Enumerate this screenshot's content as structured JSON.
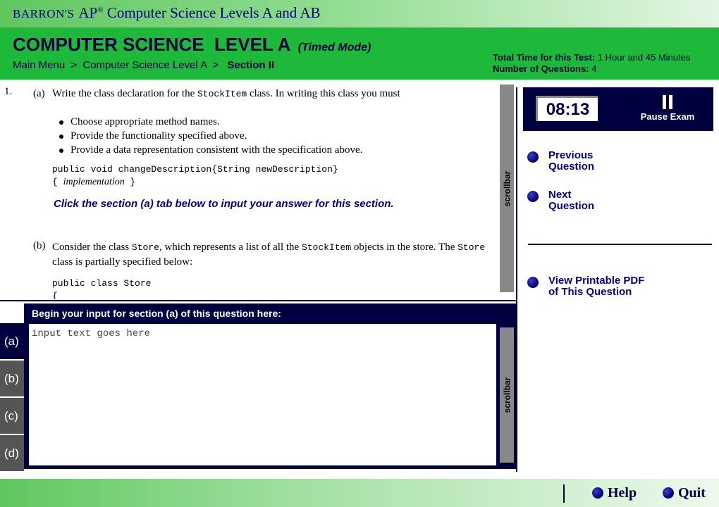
{
  "app": {
    "publisher": "BARRON'S",
    "title_prefix": "AP",
    "title_reg": "®",
    "title_rest": "Computer Science Levels A and AB"
  },
  "header": {
    "section_title": "COMPUTER SCIENCE  LEVEL A",
    "mode": "(Timed Mode)",
    "breadcrumb": {
      "main_menu": "Main Menu",
      "sep": ">",
      "level": "Computer Science Level A",
      "current": "Section II"
    },
    "total_time_label": "Total Time for this Test:",
    "total_time_value": "1 Hour and 45 Minutes",
    "num_questions_label": "Number of Questions:",
    "num_questions_value": "4"
  },
  "question": {
    "number": "1.",
    "part_a_label": "(a)",
    "part_a_text_1": "Write the class declaration for the",
    "part_a_code": "StockItem",
    "part_a_text_2": "class. In writing this class you must",
    "bullets": [
      "Choose appropriate method names.",
      "Provide the functionality specified above.",
      "Provide a data representation consistent with the specification above."
    ],
    "code_line_1": "public void changeDescription{String newDescription}",
    "code_line_2_open": "{",
    "code_line_2_impl": "implementation",
    "code_line_2_close": "}",
    "instruction": "Click the section (a) tab below to input your answer for this section.",
    "part_b_label": "(b)",
    "part_b_text_1": "Consider the class",
    "part_b_code_1": "Store",
    "part_b_text_2": ", which represents a list of all the",
    "part_b_code_2": "StockItem",
    "part_b_text_3": "objects in the store. The",
    "part_b_code_3": "Store",
    "part_b_text_4": "class is partially specified below:",
    "code_b_line_1": "public class Store",
    "code_b_line_2": "{"
  },
  "scrollbars": {
    "question_label": "scrollbar",
    "input_label": "scrollbar"
  },
  "input_panel": {
    "header": "Begin your input for section (a) of this question here:",
    "placeholder": "input text goes here",
    "value": ""
  },
  "section_tabs": [
    {
      "label": "(a)",
      "active": true
    },
    {
      "label": "(b)",
      "active": false
    },
    {
      "label": "(c)",
      "active": false
    },
    {
      "label": "(d)",
      "active": false
    }
  ],
  "timer": {
    "time": "08:13",
    "pause_label": "Pause Exam"
  },
  "nav": {
    "previous_line1": "Previous",
    "previous_line2": "Question",
    "next_line1": "Next",
    "next_line2": "Question",
    "pdf_line1": "View Printable PDF",
    "pdf_line2": "of This Question"
  },
  "footer": {
    "help": "Help",
    "quit": "Quit"
  },
  "colors": {
    "navy": "#000040",
    "header_green": "#1eb83a",
    "link_blue": "#000080",
    "tab_gray": "#555555",
    "scrollbar_gray": "#888888"
  },
  "icons": [
    "pause-icon",
    "radio-dot-icon"
  ]
}
